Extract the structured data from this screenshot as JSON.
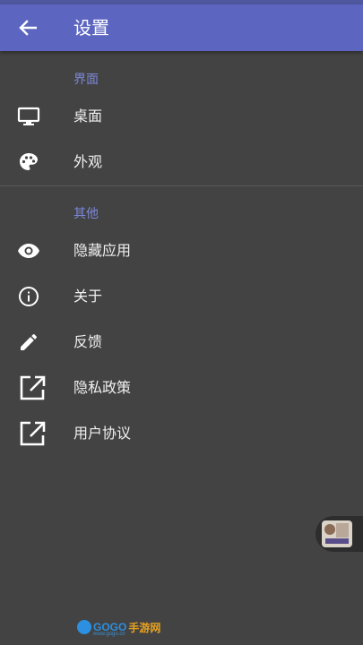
{
  "colors": {
    "primary": "#5c66c0",
    "accent": "#7c87d8",
    "background": "#434343"
  },
  "appbar": {
    "title": "设置",
    "back_icon": "arrow-left-icon"
  },
  "sections": [
    {
      "header": "界面",
      "items": [
        {
          "label": "桌面",
          "icon": "monitor-icon"
        },
        {
          "label": "外观",
          "icon": "palette-icon"
        }
      ]
    },
    {
      "header": "其他",
      "items": [
        {
          "label": "隐藏应用",
          "icon": "eye-icon"
        },
        {
          "label": "关于",
          "icon": "info-icon"
        },
        {
          "label": "反馈",
          "icon": "pencil-icon"
        },
        {
          "label": "隐私政策",
          "icon": "open-in-new-icon"
        },
        {
          "label": "用户协议",
          "icon": "open-in-new-icon"
        }
      ]
    }
  ],
  "watermark": {
    "brand": "GOGO",
    "cn": "手游网",
    "sub": "www.gogo.cn"
  }
}
